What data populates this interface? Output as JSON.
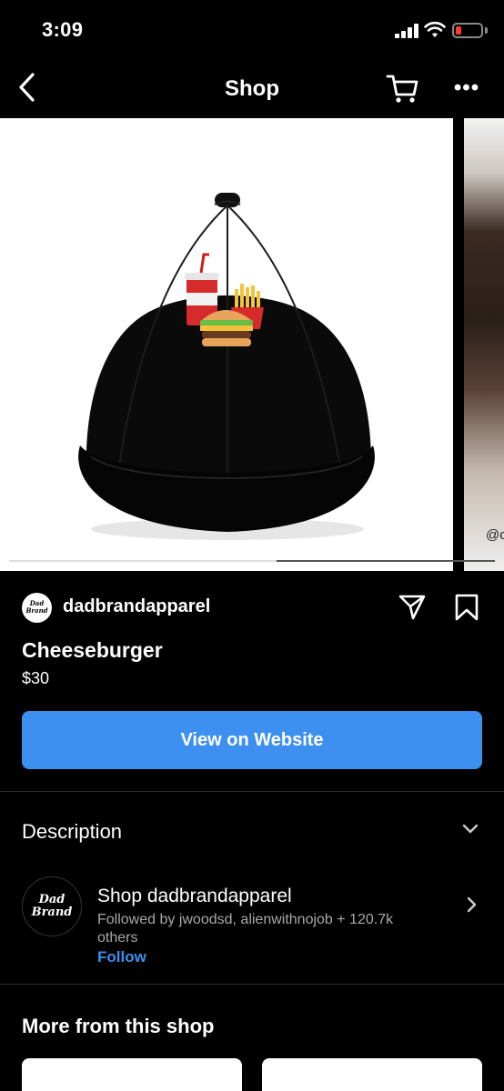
{
  "status_bar": {
    "time": "3:09",
    "battery_color": "#ff3b30"
  },
  "nav": {
    "title": "Shop",
    "back_icon": "chevron-left-icon",
    "cart_icon": "cart-icon",
    "more_icon": "more-horizontal-icon",
    "more_glyph": "•••"
  },
  "carousel": {
    "next_image_handle": "@c",
    "progress_fraction": 0.55
  },
  "product": {
    "shop_avatar_text": "Dad Brand",
    "shop_name": "dadbrandapparel",
    "title": "Cheeseburger",
    "price": "$30",
    "cta_label": "View on Website",
    "cta_color": "#3d8ff0"
  },
  "description": {
    "label": "Description"
  },
  "shop_card": {
    "avatar_text": "Dad Brand",
    "title": "Shop dadbrandapparel",
    "followed_by": "Followed by jwoodsd, alienwithnojob + 120.7k others",
    "follow_label": "Follow"
  },
  "more_from_shop": {
    "title": "More from this shop"
  }
}
